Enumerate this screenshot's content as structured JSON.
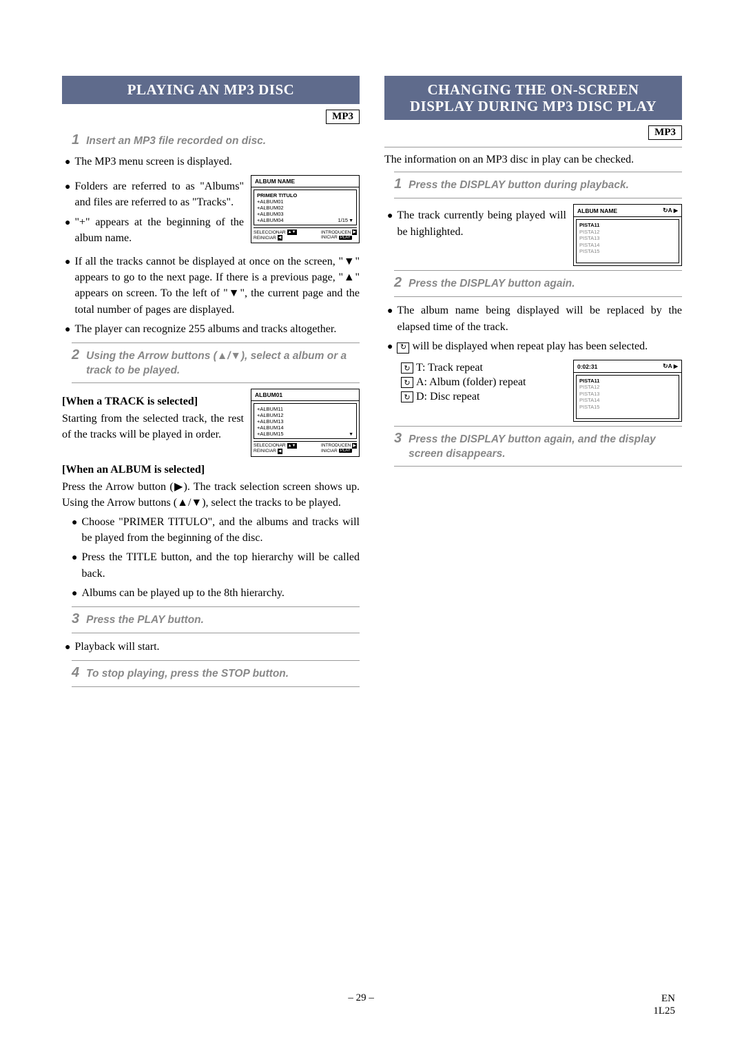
{
  "page_number": "– 29 –",
  "footer_right_top": "EN",
  "footer_right_bottom": "1L25",
  "left": {
    "title": "PLAYING AN MP3 DISC",
    "badge": "MP3",
    "step1": "Insert an MP3 file recorded on disc.",
    "b1": "The MP3 menu screen is displayed.",
    "b2": "Folders are referred to as \"Albums\" and files are referred to as \"Tracks\".",
    "b3": "\"+\" appears at the beginning of the album name.",
    "b4": "If all the tracks cannot be displayed at once on the screen, \"▼\" appears to go to the next page. If there is a previous page, \"▲\" appears on screen. To the left of \"▼\", the current page and the total number of pages are displayed.",
    "b5": "The player can recognize 255 albums and tracks altogether.",
    "step2": "Using the Arrow buttons (▲/▼), select a album or a track to be played.",
    "sub1_head": "[When a TRACK is selected]",
    "sub1_body": "Starting from the selected track, the rest of the tracks will be played in order.",
    "sub2_head": "[When an ALBUM is selected]",
    "sub2_body": "Press the Arrow button (▶). The track selection screen shows up. Using the Arrow buttons (▲/▼), select the tracks to be played.",
    "b6": "Choose \"PRIMER TITULO\", and the albums and tracks will be played from the beginning of the disc.",
    "b7": "Press the TITLE button, and the top hierarchy will be called back.",
    "b8": "Albums can be played up to the 8th hierarchy.",
    "step3": "Press the PLAY button.",
    "b9": "Playback will start.",
    "step4": "To stop playing, press the STOP button.",
    "screen1": {
      "header": "ALBUM NAME",
      "lines": [
        "PRIMER TITULO",
        "+ALBUM01",
        "+ALBUM02",
        "+ALBUM03",
        "+ALBUM04"
      ],
      "page": "1/15",
      "footL1": "SELECCIONAR",
      "footL2": "REINICIAR",
      "footR1": "INTRODUCEN",
      "footR2": "INICIAR",
      "footR2b": "PLAY"
    },
    "screen2": {
      "header": "ALBUM01",
      "lines": [
        "+ALBUM11",
        "+ALBUM12",
        "+ALBUM13",
        "+ALBUM14",
        "+ALBUM15"
      ],
      "footL1": "SELECCIONAR",
      "footL2": "REINICIAR",
      "footR1": "INTRODUCEN",
      "footR2": "INICIAR",
      "footR2b": "PLAY"
    }
  },
  "right": {
    "title_line1": "CHANGING THE ON-SCREEN",
    "title_line2": "DISPLAY DURING MP3 DISC PLAY",
    "badge": "MP3",
    "intro": "The information on an MP3 disc in play can be checked.",
    "step1": "Press the DISPLAY button during playback.",
    "b1": "The track currently being played will be highlighted.",
    "step2": "Press the DISPLAY button again.",
    "b2": "The album name being displayed will be replaced by the elapsed time of the track.",
    "b3_pre": "",
    "b3_post": "will be displayed when repeat play has been selected.",
    "repeat_t": "T: Track repeat",
    "repeat_a": "A: Album (folder) repeat",
    "repeat_d": "D: Disc repeat",
    "step3": "Press the DISPLAY button again, and the display screen disappears.",
    "screen1": {
      "header": "ALBUM NAME",
      "header_right_loop": "A",
      "lines": [
        "PISTA11",
        "PISTA12",
        "PISTA13",
        "PISTA14",
        "PISTA15"
      ]
    },
    "screen2": {
      "header": "0:02:31",
      "header_right_loop": "A",
      "lines": [
        "PISTA11",
        "PISTA12",
        "PISTA13",
        "PISTA14",
        "PISTA15"
      ]
    }
  }
}
